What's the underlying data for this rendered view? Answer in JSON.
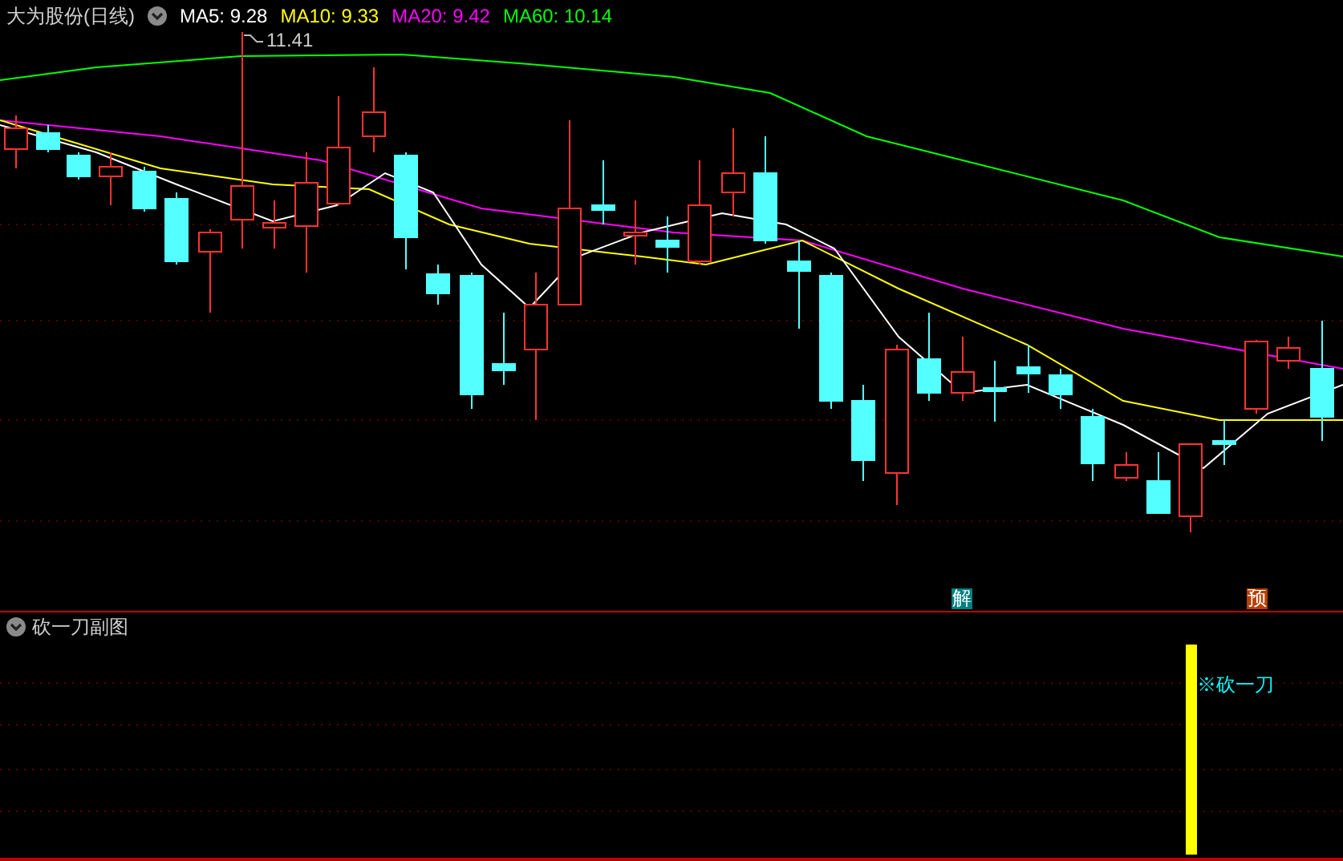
{
  "main_chart": {
    "title": "大为股份(日线)",
    "ma_readings": [
      {
        "label": "MA5: 9.28",
        "color": "#ffffff"
      },
      {
        "label": "MA10: 9.33",
        "color": "#ffff00"
      },
      {
        "label": "MA20: 9.42",
        "color": "#ff00ff"
      },
      {
        "label": "MA60: 10.14",
        "color": "#00ff00"
      }
    ],
    "peak_label": "11.41",
    "signal_markers": [
      {
        "label": "解",
        "color": "#008080"
      },
      {
        "label": "预",
        "color": "#b84000"
      }
    ]
  },
  "sub_chart": {
    "title": "砍一刀副图",
    "signal_label": "※砍一刀"
  }
}
